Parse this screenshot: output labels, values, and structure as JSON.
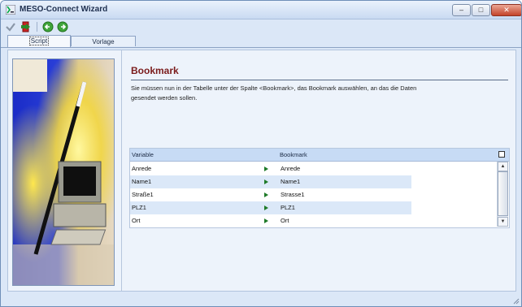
{
  "window": {
    "title": "MESO-Connect Wizard",
    "btn_min": "–",
    "btn_max": "□",
    "btn_close": "✕"
  },
  "tabs": [
    {
      "label": "Script"
    },
    {
      "label": "Vorlage"
    }
  ],
  "section": {
    "heading": "Bookmark",
    "description": "Sie müssen nun in der Tabelle unter der Spalte <Bookmark>, das Bookmark auswählen, an das die Daten\n gesendet werden sollen."
  },
  "grid": {
    "columns": [
      "Variable",
      "Bookmark"
    ],
    "rows": [
      {
        "variable": "Anrede",
        "bookmark": "Anrede"
      },
      {
        "variable": "Name1",
        "bookmark": "Name1"
      },
      {
        "variable": "Straße1",
        "bookmark": "Strasse1"
      },
      {
        "variable": "PLZ1",
        "bookmark": "PLZ1"
      },
      {
        "variable": "Ort",
        "bookmark": "Ort"
      }
    ],
    "scroll_up": "▲",
    "scroll_down": "▼"
  },
  "toolbar_icons": [
    "check-icon",
    "exit-icon",
    "back-icon",
    "forward-icon"
  ],
  "colors": {
    "heading": "#7a1b1b",
    "arrow": "#1e7a28",
    "row_alt": "#dbe8f8",
    "header": "#c7dbf5"
  }
}
